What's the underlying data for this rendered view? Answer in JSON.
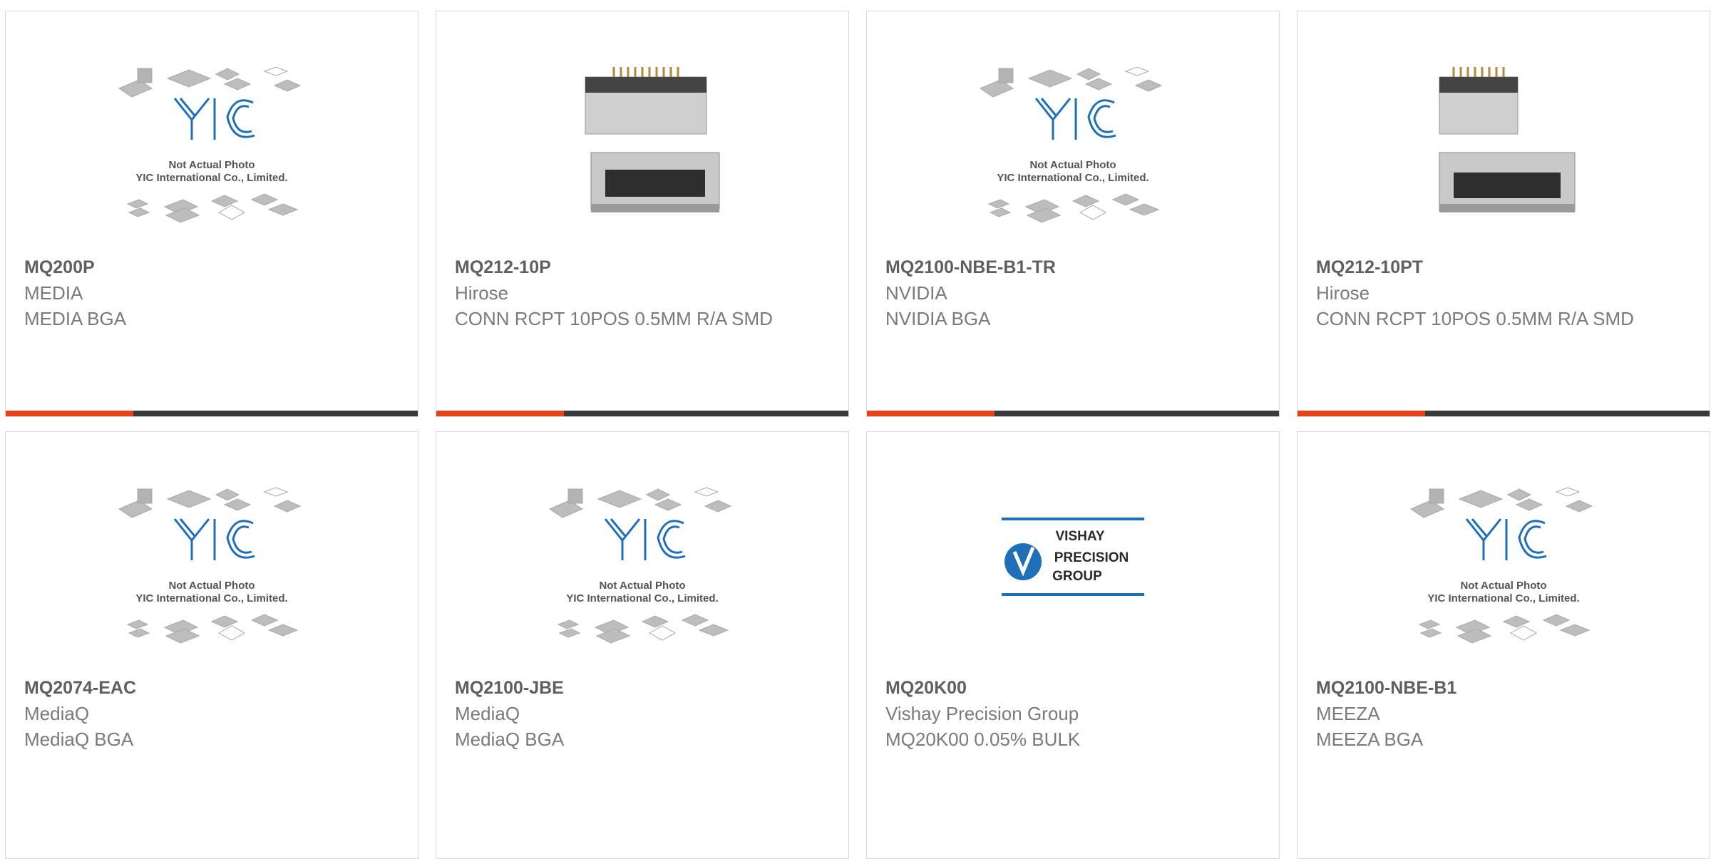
{
  "colors": {
    "accent": "#e8421a",
    "bar": "#3a3a3a",
    "logo_blue": "#1e6fb8"
  },
  "placeholder_image": {
    "line1": "Not Actual Photo",
    "line2": "YIC International Co., Limited.",
    "logo_text": "YIC"
  },
  "vishay_logo": {
    "line1": "VISHAY",
    "line2": "PRECISION",
    "line3": "GROUP"
  },
  "products": [
    {
      "part": "MQ200P",
      "manufacturer": "MEDIA",
      "description": "MEDIA BGA",
      "image": "yic-placeholder",
      "progress": 0.31
    },
    {
      "part": "MQ212-10P",
      "manufacturer": "Hirose",
      "description": "CONN RCPT 10POS 0.5MM R/A SMD",
      "image": "connector-photo",
      "progress": 0.31
    },
    {
      "part": "MQ2100-NBE-B1-TR",
      "manufacturer": "NVIDIA",
      "description": "NVIDIA BGA",
      "image": "yic-placeholder",
      "progress": 0.31
    },
    {
      "part": "MQ212-10PT",
      "manufacturer": "Hirose",
      "description": "CONN RCPT 10POS 0.5MM R/A SMD",
      "image": "connector-photo",
      "progress": 0.31
    },
    {
      "part": "MQ2074-EAC",
      "manufacturer": "MediaQ",
      "description": "MediaQ BGA",
      "image": "yic-placeholder"
    },
    {
      "part": "MQ2100-JBE",
      "manufacturer": "MediaQ",
      "description": "MediaQ BGA",
      "image": "yic-placeholder"
    },
    {
      "part": "MQ20K00",
      "manufacturer": "Vishay Precision Group",
      "description": "MQ20K00 0.05% BULK",
      "image": "vishay-logo"
    },
    {
      "part": "MQ2100-NBE-B1",
      "manufacturer": "MEEZA",
      "description": "MEEZA BGA",
      "image": "yic-placeholder"
    }
  ]
}
